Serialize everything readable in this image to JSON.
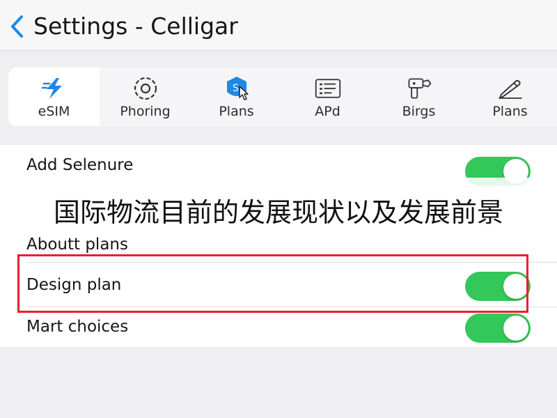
{
  "header": {
    "title": "Settings - Celligar",
    "back_icon": "chevron-left-icon"
  },
  "tabs": [
    {
      "label": "eSIM",
      "icon": "bolt-icon",
      "active": true
    },
    {
      "label": "Phoring",
      "icon": "ring-icon",
      "active": false
    },
    {
      "label": "Plans",
      "icon": "shield-pointer-icon",
      "active": false
    },
    {
      "label": "APd",
      "icon": "list-document-icon",
      "active": false
    },
    {
      "label": "Birgs",
      "icon": "device-tool-icon",
      "active": false
    },
    {
      "label": "Plans",
      "icon": "pencil-icon",
      "active": false
    }
  ],
  "settings": {
    "add_selenure": {
      "label": "Add Selenure",
      "enabled": true
    },
    "about_plans": {
      "label": "Aboutt plans"
    },
    "design_plan": {
      "label": "Design plan",
      "enabled": true
    },
    "mart_choices": {
      "label": "Mart choices",
      "enabled": true
    }
  },
  "overlay": {
    "caption": "国际物流目前的发展现状以及发展前景"
  },
  "colors": {
    "accent_blue": "#1e88e5",
    "toggle_on": "#34c759",
    "highlight_red": "#e8202a",
    "background": "#efeff2"
  }
}
